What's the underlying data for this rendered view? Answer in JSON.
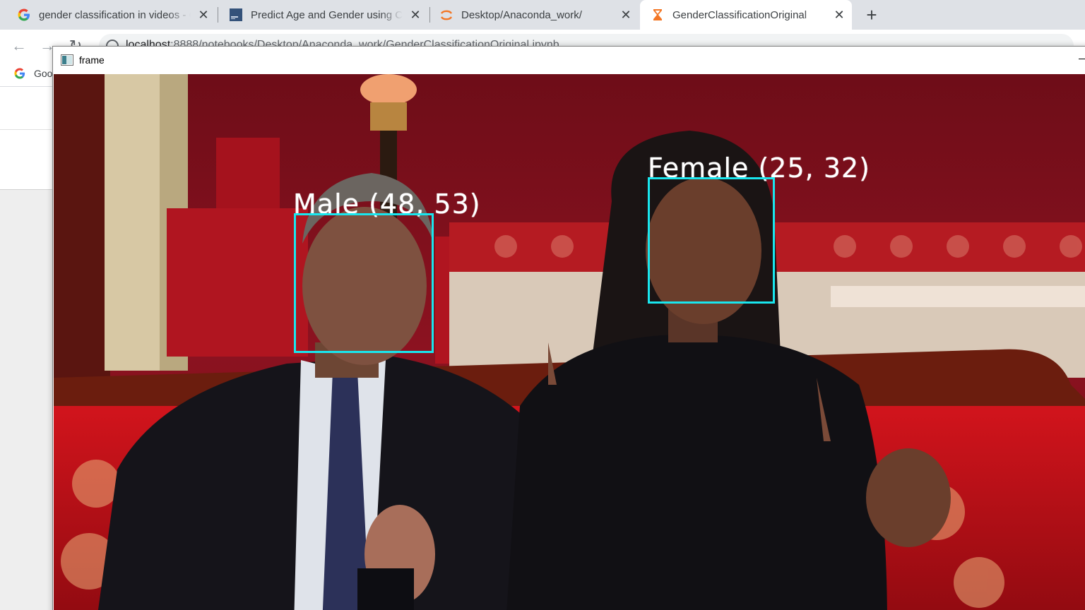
{
  "browser": {
    "tabs": [
      {
        "title": "gender classification in videos - Google Search",
        "icon": "google-icon",
        "active": false
      },
      {
        "title": "Predict Age and Gender using Convolutional Neural Network",
        "icon": "site-thumbnail-icon",
        "active": false
      },
      {
        "title": "Desktop/Anaconda_work/",
        "icon": "jupyter-icon",
        "active": false
      },
      {
        "title": "GenderClassificationOriginal",
        "icon": "hourglass-icon",
        "active": true
      }
    ],
    "new_tab_label": "+",
    "close_glyph": "✕",
    "address": {
      "host": "localhost",
      "rest": ":8888/notebooks/Desktop/Anaconda_work/GenderClassificationOriginal.ipynb"
    },
    "bookmarks": [
      {
        "label": "Goo",
        "icon": "google-icon"
      }
    ]
  },
  "cv_window": {
    "title": "frame",
    "icon": "window-app-icon",
    "detections": [
      {
        "label": "Male (48, 53)",
        "color": "#19e6ee"
      },
      {
        "label": "Female (25, 32)",
        "color": "#19e6ee"
      }
    ]
  },
  "colors": {
    "tabstrip": "#dee1e6",
    "active_tab": "#ffffff",
    "box": "#19e6ee",
    "wall": "#8c1220"
  }
}
